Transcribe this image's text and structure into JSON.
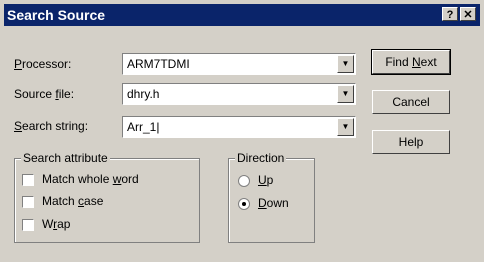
{
  "window": {
    "title": "Search Source",
    "help_glyph": "?",
    "close_glyph": "✕"
  },
  "fields": {
    "processor": {
      "label_pre": "",
      "label_key": "P",
      "label_post": "rocessor:",
      "value": "ARM7TDMI"
    },
    "source_file": {
      "label_pre": "Source ",
      "label_key": "f",
      "label_post": "ile:",
      "value": "dhry.h"
    },
    "search_string": {
      "label_pre": "",
      "label_key": "S",
      "label_post": "earch string:",
      "value": "Arr_1|"
    }
  },
  "buttons": {
    "find_next": {
      "pre": "Find ",
      "key": "N",
      "post": "ext"
    },
    "cancel": "Cancel",
    "help": "Help"
  },
  "search_attribute": {
    "legend": "Search attribute",
    "options": [
      {
        "pre": "Match whole ",
        "key": "w",
        "post": "ord",
        "checked": false
      },
      {
        "pre": "Match ",
        "key": "c",
        "post": "ase",
        "checked": false
      },
      {
        "pre": "W",
        "key": "r",
        "post": "ap",
        "checked": false
      }
    ]
  },
  "direction": {
    "legend": "Direction",
    "options": [
      {
        "pre": "",
        "key": "U",
        "post": "p",
        "selected": false
      },
      {
        "pre": "",
        "key": "D",
        "post": "own",
        "selected": true
      }
    ]
  }
}
